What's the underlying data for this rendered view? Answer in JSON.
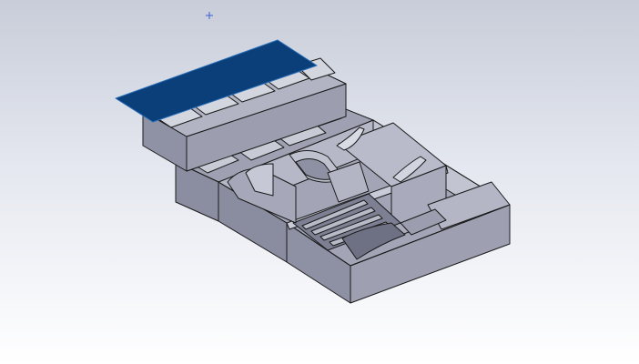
{
  "viewport": {
    "background_top": "#c8cdd9",
    "background_bottom": "#ffffff"
  },
  "model": {
    "face_color_light": "#a8aabb",
    "face_color_mid": "#8f91a4",
    "face_color_dark": "#6e7084",
    "edge_color": "#1a1a1a",
    "selected_face_color": "#0a3f7a",
    "selected_edge_color": "#2a6fb8",
    "origin_marker_color": "#3c5fd0"
  }
}
